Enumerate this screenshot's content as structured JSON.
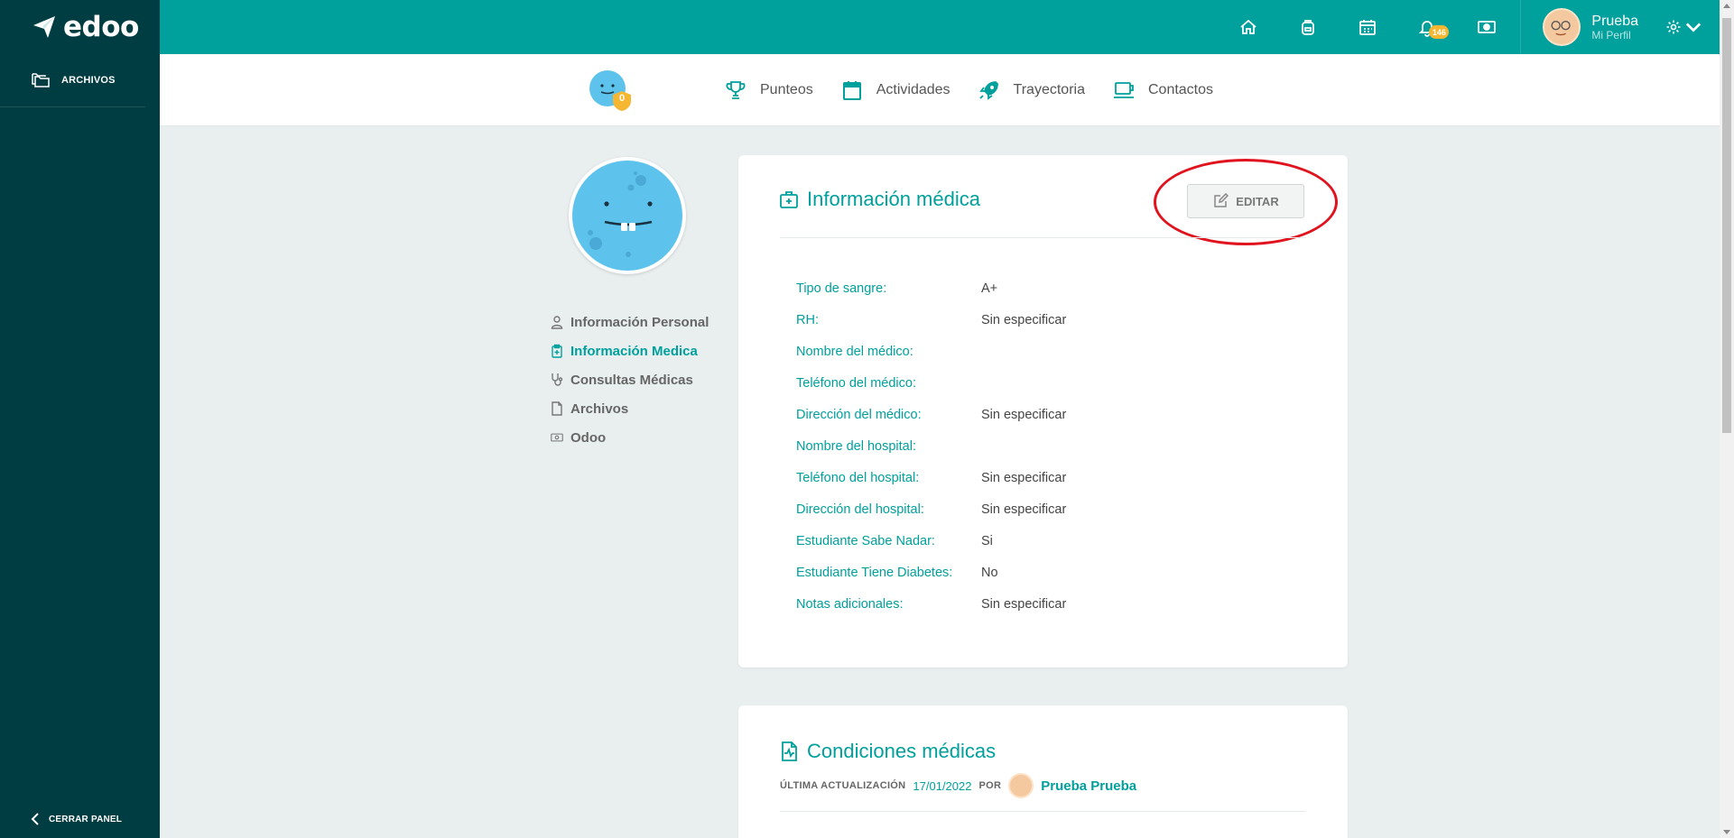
{
  "app": {
    "brand": "edoo"
  },
  "sidebar": {
    "items": [
      {
        "label": "ARCHIVOS",
        "icon": "folders-icon"
      }
    ],
    "collapse_label": "CERRAR PANEL"
  },
  "topbar": {
    "icons": [
      "home-icon",
      "backpack-icon",
      "calendar-icon",
      "bell-icon",
      "money-icon"
    ],
    "notification_count": "146",
    "user_name": "Prueba",
    "user_sub": "Mi Perfil"
  },
  "profile_tabs": {
    "badge_count": "0",
    "tabs": [
      {
        "label": "Punteos",
        "icon": "trophy-icon"
      },
      {
        "label": "Actividades",
        "icon": "calendar-icon"
      },
      {
        "label": "Trayectoria",
        "icon": "rocket-icon"
      },
      {
        "label": "Contactos",
        "icon": "contacts-icon"
      }
    ]
  },
  "submenu": {
    "items": [
      {
        "label": "Información Personal",
        "icon": "user-icon",
        "active": false
      },
      {
        "label": "Información Medica",
        "icon": "clipboard-icon",
        "active": true
      },
      {
        "label": "Consultas Médicas",
        "icon": "stethoscope-icon",
        "active": false
      },
      {
        "label": "Archivos",
        "icon": "file-icon",
        "active": false
      },
      {
        "label": "Odoo",
        "icon": "cash-icon",
        "active": false
      }
    ]
  },
  "medical_info": {
    "title": "Información médica",
    "edit_label": "EDITAR",
    "fields": [
      {
        "label": "Tipo de sangre:",
        "value": "A+"
      },
      {
        "label": "RH:",
        "value": "Sin especificar"
      },
      {
        "label": "Nombre del médico:",
        "value": ""
      },
      {
        "label": "Teléfono del médico:",
        "value": ""
      },
      {
        "label": "Dirección del médico:",
        "value": "Sin especificar"
      },
      {
        "label": "Nombre del hospital:",
        "value": ""
      },
      {
        "label": "Teléfono del hospital:",
        "value": "Sin especificar"
      },
      {
        "label": "Dirección del hospital:",
        "value": "Sin especificar"
      },
      {
        "label": "Estudiante Sabe Nadar:",
        "value": "Si"
      },
      {
        "label": "Estudiante Tiene Diabetes:",
        "value": "No"
      },
      {
        "label": "Notas adicionales:",
        "value": "Sin especificar"
      }
    ]
  },
  "medical_conditions": {
    "title": "Condiciones médicas",
    "updated_label": "ÚLTIMA ACTUALIZACIÓN",
    "updated_date": "17/01/2022",
    "by_label": "POR",
    "updated_by": "Prueba Prueba"
  },
  "colors": {
    "accent": "#00a09d",
    "sidebar": "#003d42",
    "badge": "#f5b731",
    "highlight": "#e0141e"
  }
}
